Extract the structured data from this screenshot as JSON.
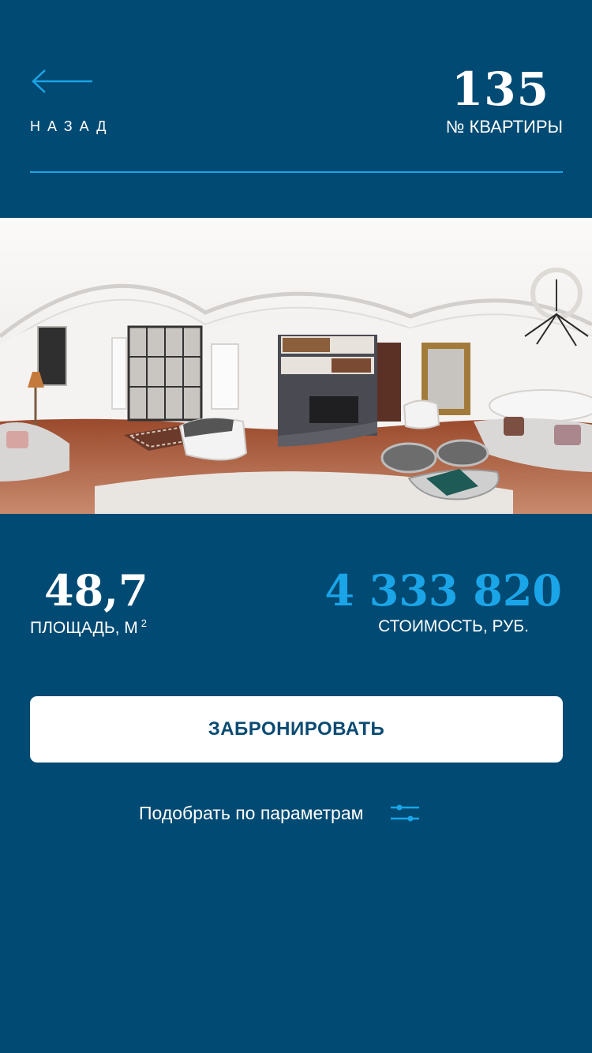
{
  "header": {
    "back_label": "НАЗАД",
    "apartment_number": "135",
    "apartment_label": "№ КВАРТИРЫ"
  },
  "icons": {
    "back": "arrow-left-icon",
    "filter": "sliders-icon"
  },
  "panorama": {
    "description_name": "apartment-panorama"
  },
  "stats": {
    "area_value": "48,7",
    "area_label": "ПЛОЩАДЬ, М",
    "area_unit_sup": "2",
    "price_value": "4 333 820",
    "price_label": "СТОИМОСТЬ, РУБ."
  },
  "actions": {
    "book_label": "ЗАБРОНИРОВАТЬ",
    "filter_label": "Подобрать по параметрам"
  },
  "colors": {
    "background": "#004a73",
    "accent": "#1aa5e8",
    "button_bg": "#ffffff",
    "button_text": "#0a4b73"
  }
}
